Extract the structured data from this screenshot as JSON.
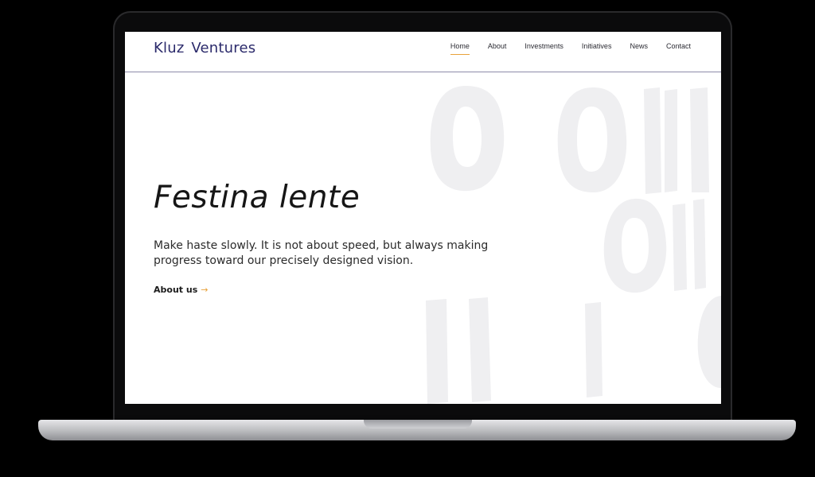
{
  "site": {
    "logo": "Kluz  Ventures"
  },
  "nav": {
    "items": [
      {
        "label": "Home",
        "active": true
      },
      {
        "label": "About"
      },
      {
        "label": "Investments"
      },
      {
        "label": "Initiatives"
      },
      {
        "label": "News"
      },
      {
        "label": "Contact"
      }
    ]
  },
  "hero": {
    "title": "Festina lente",
    "description": "Make haste slowly. It is not about speed, but always making progress toward our precisely designed vision.",
    "link_label": "About us",
    "link_arrow": "→"
  },
  "colors": {
    "brand": "#2b2a6b",
    "accent": "#e8a23a",
    "decor": "#f0f0f1"
  }
}
